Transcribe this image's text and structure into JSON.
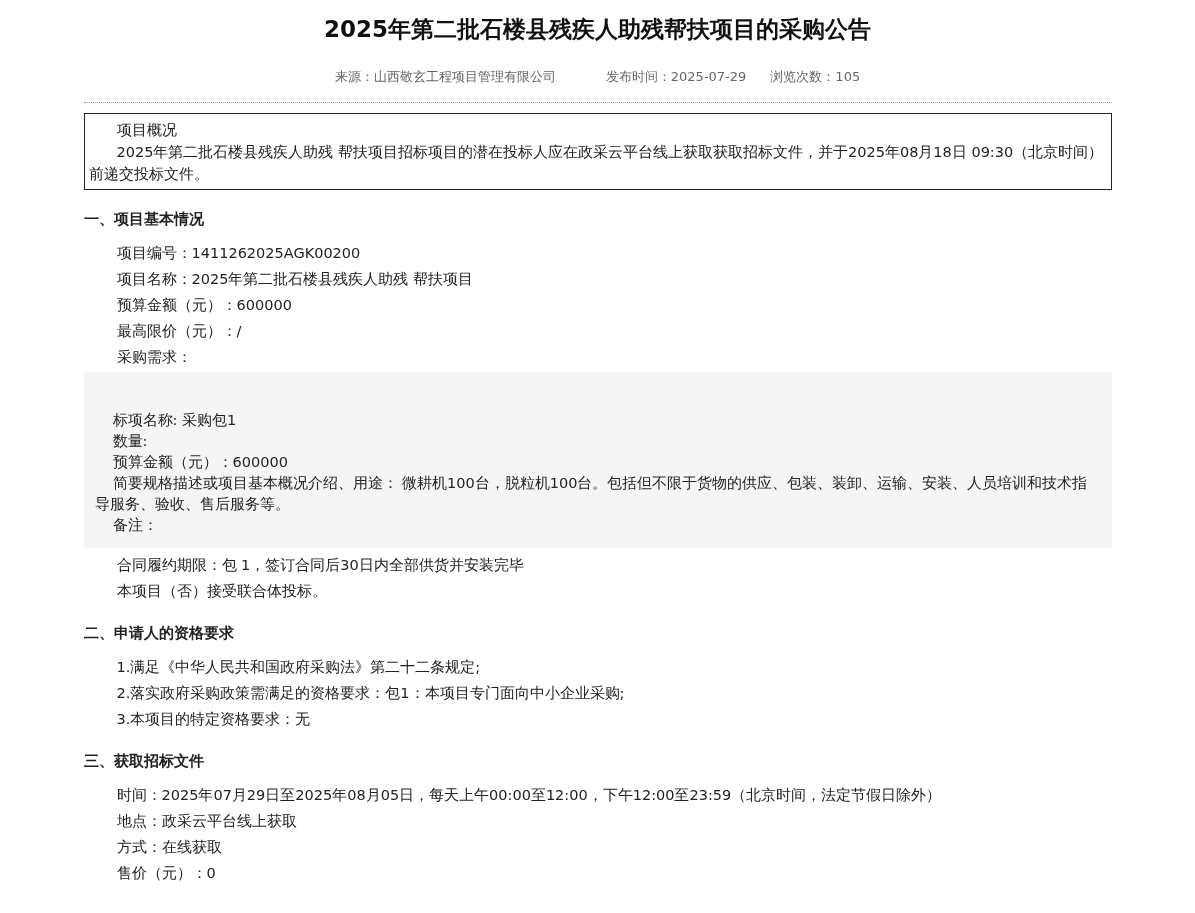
{
  "title": "2025年第二批石楼县残疾人助残帮扶项目的采购公告",
  "meta": [
    "来源：山西敬玄工程项目管理有限公司",
    "发布时间：2025-07-29",
    "浏览次数：105"
  ],
  "overview": {
    "heading": "项目概况",
    "text": "2025年第二批石楼县残疾人助残 帮扶项目招标项目的潜在投标人应在政采云平台线上获取获取招标文件，并于2025年08月18日 09:30（北京时间）前递交投标文件。"
  },
  "sections": [
    {
      "heading": "一、项目基本情况",
      "items": [
        {
          "kind": "line",
          "text": "项目编号：1411262025AGK00200"
        },
        {
          "kind": "line",
          "text": "项目名称：2025年第二批石楼县残疾人助残 帮扶项目"
        },
        {
          "kind": "line",
          "text": "预算金额（元）：600000"
        },
        {
          "kind": "line",
          "text": "最高限价（元）：/"
        },
        {
          "kind": "line",
          "text": "采购需求："
        },
        {
          "kind": "panel",
          "lines": [
            "标项名称: 采购包1",
            "数量:",
            "预算金额（元）：600000",
            "简要规格描述或项目基本概况介绍、用途： 微耕机100台，脱粒机100台。包括但不限于货物的供应、包装、装卸、运输、安装、人员培训和技术指导服务、验收、售后服务等。",
            "备注："
          ]
        },
        {
          "kind": "line",
          "text": "合同履约期限：包 1，签订合同后30日内全部供货并安装完毕"
        },
        {
          "kind": "line",
          "text": "本项目（否）接受联合体投标。"
        }
      ]
    },
    {
      "heading": "二、申请人的资格要求",
      "items": [
        {
          "kind": "line",
          "text": "1.满足《中华人民共和国政府采购法》第二十二条规定;"
        },
        {
          "kind": "line",
          "text": "2.落实政府采购政策需满足的资格要求：包1：本项目专门面向中小企业采购;"
        },
        {
          "kind": "line",
          "text": "3.本项目的特定资格要求：无"
        }
      ]
    },
    {
      "heading": "三、获取招标文件",
      "items": [
        {
          "kind": "line",
          "text": "时间：2025年07月29日至2025年08月05日，每天上午00:00至12:00，下午12:00至23:59（北京时间，法定节假日除外）"
        },
        {
          "kind": "line",
          "text": "地点：政采云平台线上获取"
        },
        {
          "kind": "line",
          "text": "方式：在线获取"
        },
        {
          "kind": "line",
          "text": "售价（元）：0"
        }
      ]
    }
  ]
}
